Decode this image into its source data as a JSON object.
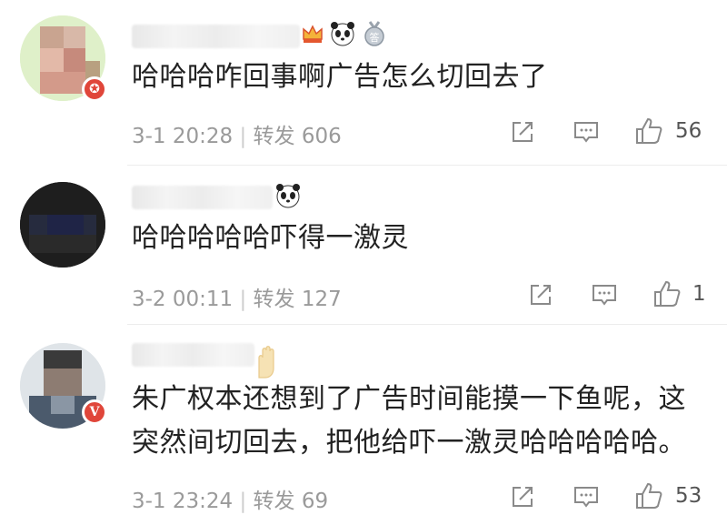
{
  "comments": [
    {
      "text": "哈哈哈咋回事啊广告怎么切回去了",
      "date": "3-1 20:28",
      "sep": "|",
      "repost_label": "转发",
      "repost_count": "606",
      "like_count": "56",
      "badges": [
        "crown-badge",
        "panda-badge",
        "medal-badge"
      ]
    },
    {
      "text": "哈哈哈哈哈吓得一激灵",
      "date": "3-2 00:11",
      "sep": "|",
      "repost_label": "转发",
      "repost_count": "127",
      "like_count": "1",
      "badges": [
        "panda-badge"
      ]
    },
    {
      "text_line1": "朱广权本还想到了广告时间能摸一下鱼呢，这",
      "text_line2": "突然间切回去，把他给吓一激灵哈哈哈哈哈。",
      "date": "3-1 23:24",
      "sep": "|",
      "repost_label": "转发",
      "repost_count": "69",
      "like_count": "53",
      "badges": [
        "hand-badge"
      ]
    }
  ],
  "colors": {
    "meta": "#9a9a9a",
    "icon": "#8a8a8a",
    "verified": "#f5a623",
    "brand_red": "#e0463a"
  }
}
